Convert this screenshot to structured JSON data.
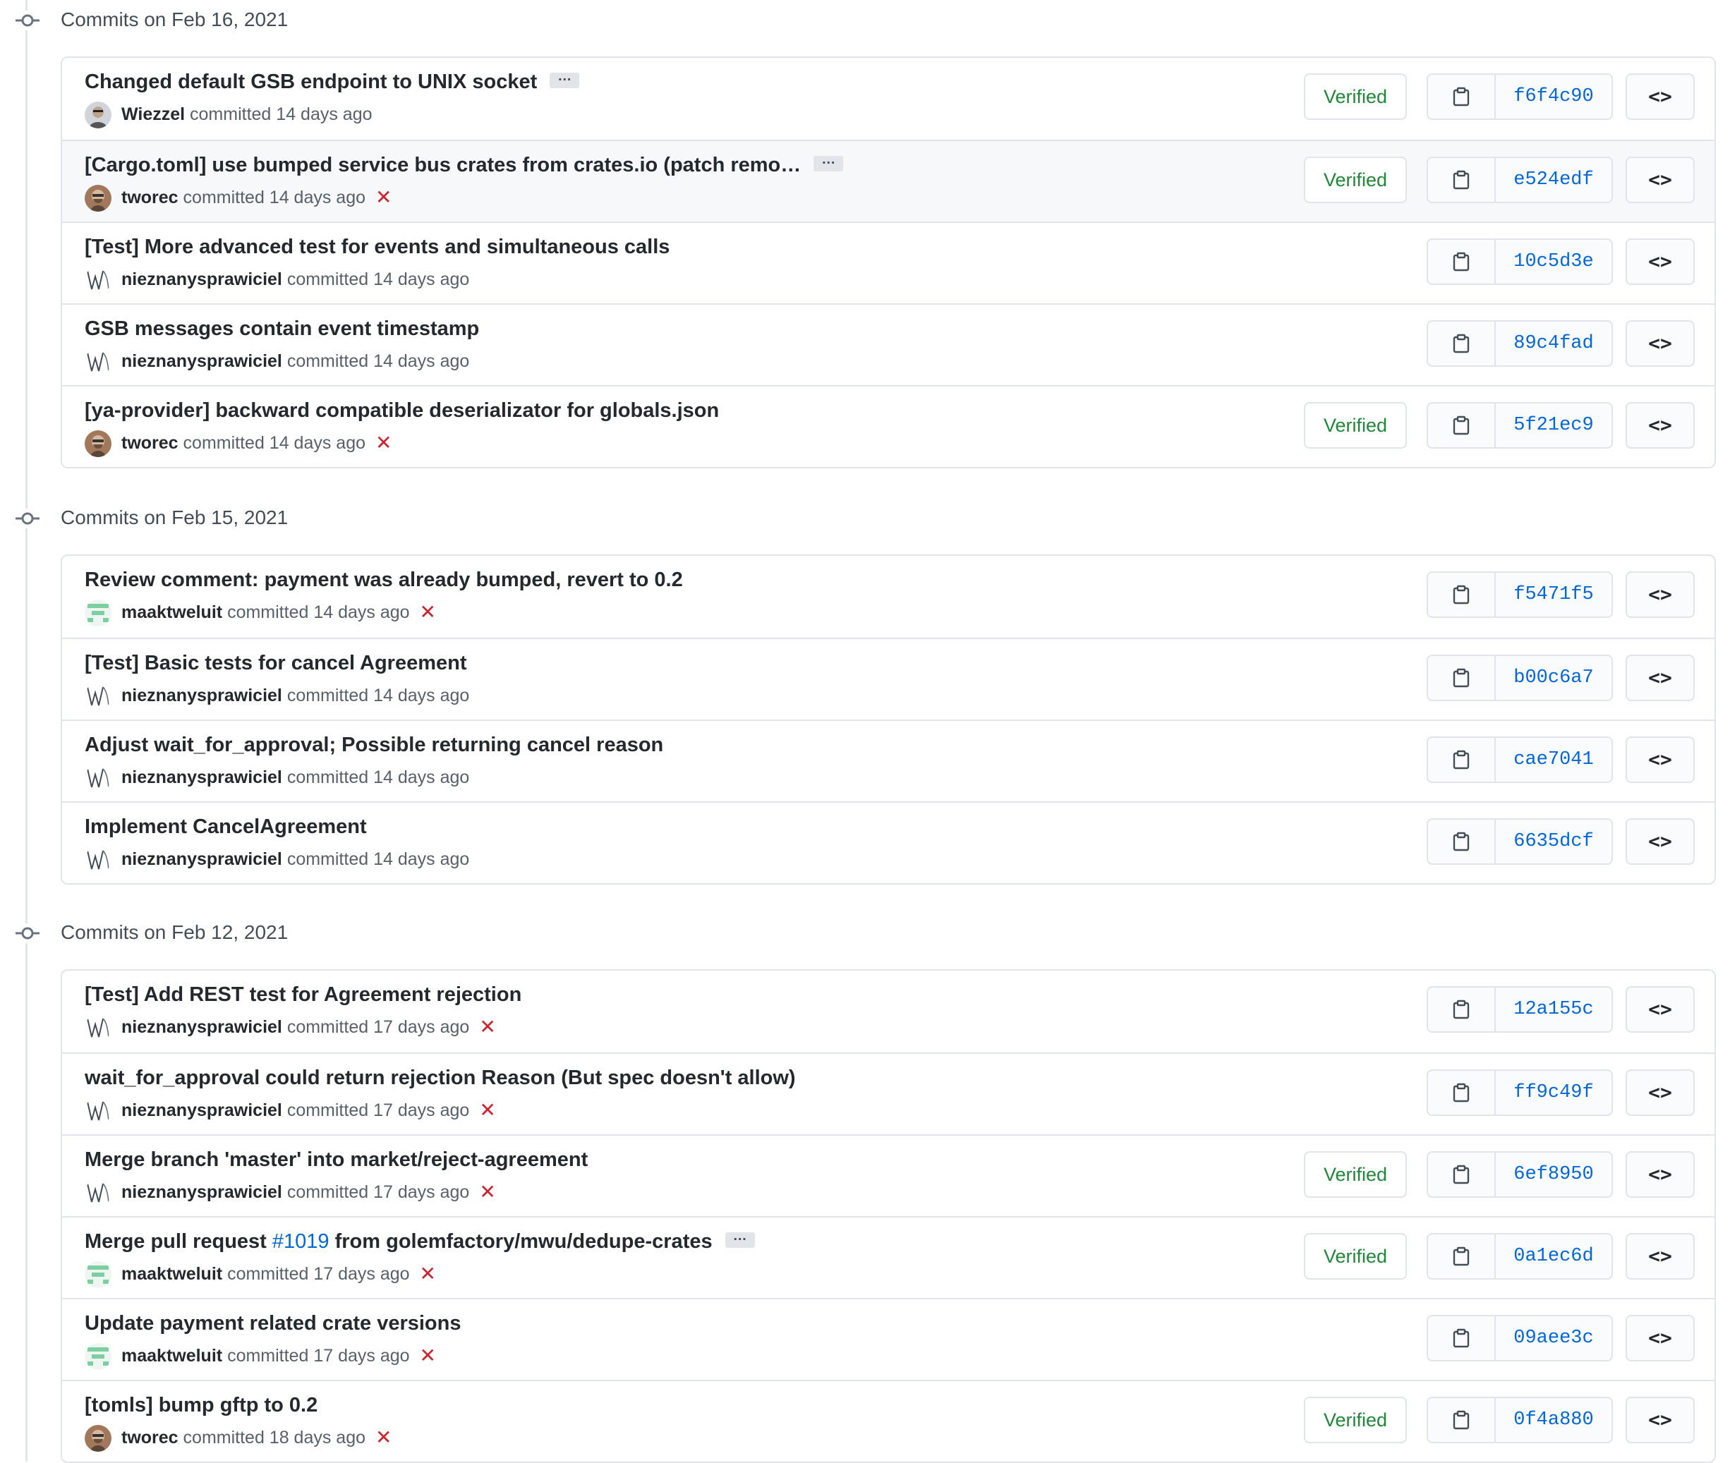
{
  "groups": [
    {
      "title": "Commits on Feb 16, 2021",
      "commits": [
        {
          "message": "Changed default GSB endpoint to UNIX socket",
          "has_ellipsis": true,
          "author": "Wiezzel",
          "avatar": "photo-gray",
          "time": "committed 14 days ago",
          "status": "",
          "verified": "Verified",
          "sha": "f6f4c90",
          "highlighted": false
        },
        {
          "message": "[Cargo.toml] use bumped service bus crates from crates.io (patch remo…",
          "has_ellipsis": true,
          "author": "tworec",
          "avatar": "photo-brown",
          "time": "committed 14 days ago",
          "status": "failed",
          "verified": "Verified",
          "sha": "e524edf",
          "highlighted": true
        },
        {
          "message": "[Test] More advanced test for events and simultaneous calls",
          "has_ellipsis": false,
          "author": "nieznanysprawiciel",
          "avatar": "wave",
          "time": "committed 14 days ago",
          "status": "",
          "verified": "",
          "sha": "10c5d3e",
          "highlighted": false
        },
        {
          "message": "GSB messages contain event timestamp",
          "has_ellipsis": false,
          "author": "nieznanysprawiciel",
          "avatar": "wave",
          "time": "committed 14 days ago",
          "status": "",
          "verified": "",
          "sha": "89c4fad",
          "highlighted": false
        },
        {
          "message": "[ya-provider] backward compatible deserializator for globals.json",
          "has_ellipsis": false,
          "author": "tworec",
          "avatar": "photo-brown",
          "time": "committed 14 days ago",
          "status": "failed",
          "verified": "Verified",
          "sha": "5f21ec9",
          "highlighted": false
        }
      ]
    },
    {
      "title": "Commits on Feb 15, 2021",
      "commits": [
        {
          "message": "Review comment: payment was already bumped, revert to 0.2",
          "has_ellipsis": false,
          "author": "maaktweluit",
          "avatar": "identicon-green",
          "time": "committed 14 days ago",
          "status": "failed",
          "verified": "",
          "sha": "f5471f5",
          "highlighted": false
        },
        {
          "message": "[Test] Basic tests for cancel Agreement",
          "has_ellipsis": false,
          "author": "nieznanysprawiciel",
          "avatar": "wave",
          "time": "committed 14 days ago",
          "status": "",
          "verified": "",
          "sha": "b00c6a7",
          "highlighted": false
        },
        {
          "message": "Adjust wait_for_approval; Possible returning cancel reason",
          "has_ellipsis": false,
          "author": "nieznanysprawiciel",
          "avatar": "wave",
          "time": "committed 14 days ago",
          "status": "",
          "verified": "",
          "sha": "cae7041",
          "highlighted": false
        },
        {
          "message": "Implement CancelAgreement",
          "has_ellipsis": false,
          "author": "nieznanysprawiciel",
          "avatar": "wave",
          "time": "committed 14 days ago",
          "status": "",
          "verified": "",
          "sha": "6635dcf",
          "highlighted": false
        }
      ]
    },
    {
      "title": "Commits on Feb 12, 2021",
      "commits": [
        {
          "message": "[Test] Add REST test for Agreement rejection",
          "has_ellipsis": false,
          "author": "nieznanysprawiciel",
          "avatar": "wave",
          "time": "committed 17 days ago",
          "status": "failed",
          "verified": "",
          "sha": "12a155c",
          "highlighted": false
        },
        {
          "message": "wait_for_approval could return rejection Reason (But spec doesn't allow)",
          "has_ellipsis": false,
          "author": "nieznanysprawiciel",
          "avatar": "wave",
          "time": "committed 17 days ago",
          "status": "failed",
          "verified": "",
          "sha": "ff9c49f",
          "highlighted": false
        },
        {
          "message": "Merge branch 'master' into market/reject-agreement",
          "has_ellipsis": false,
          "author": "nieznanysprawiciel",
          "avatar": "wave",
          "time": "committed 17 days ago",
          "status": "failed",
          "verified": "Verified",
          "sha": "6ef8950",
          "highlighted": false
        },
        {
          "message": "Merge pull request ",
          "message_link": "#1019",
          "message_after": " from golemfactory/mwu/dedupe-crates",
          "has_ellipsis": true,
          "author": "maaktweluit",
          "avatar": "identicon-green",
          "time": "committed 17 days ago",
          "status": "failed",
          "verified": "Verified",
          "sha": "0a1ec6d",
          "highlighted": false
        },
        {
          "message": "Update payment related crate versions",
          "has_ellipsis": false,
          "author": "maaktweluit",
          "avatar": "identicon-green",
          "time": "committed 17 days ago",
          "status": "failed",
          "verified": "",
          "sha": "09aee3c",
          "highlighted": false
        },
        {
          "message": "[tomls] bump gftp to 0.2",
          "has_ellipsis": false,
          "author": "tworec",
          "avatar": "photo-brown",
          "time": "committed 18 days ago",
          "status": "failed",
          "verified": "Verified",
          "sha": "0f4a880",
          "highlighted": false
        }
      ]
    }
  ],
  "labels": {
    "ellipsis": "…",
    "failed_mark": "✕",
    "code_browse": "<>"
  },
  "colors": {
    "verified": "#22863a",
    "sha_link": "#0366d6",
    "failed": "#cb2431",
    "border": "#e1e4e8"
  },
  "icons": {
    "timeline": "git-commit-icon",
    "copy": "clipboard-icon",
    "browse": "code-icon",
    "status": "x-icon"
  }
}
